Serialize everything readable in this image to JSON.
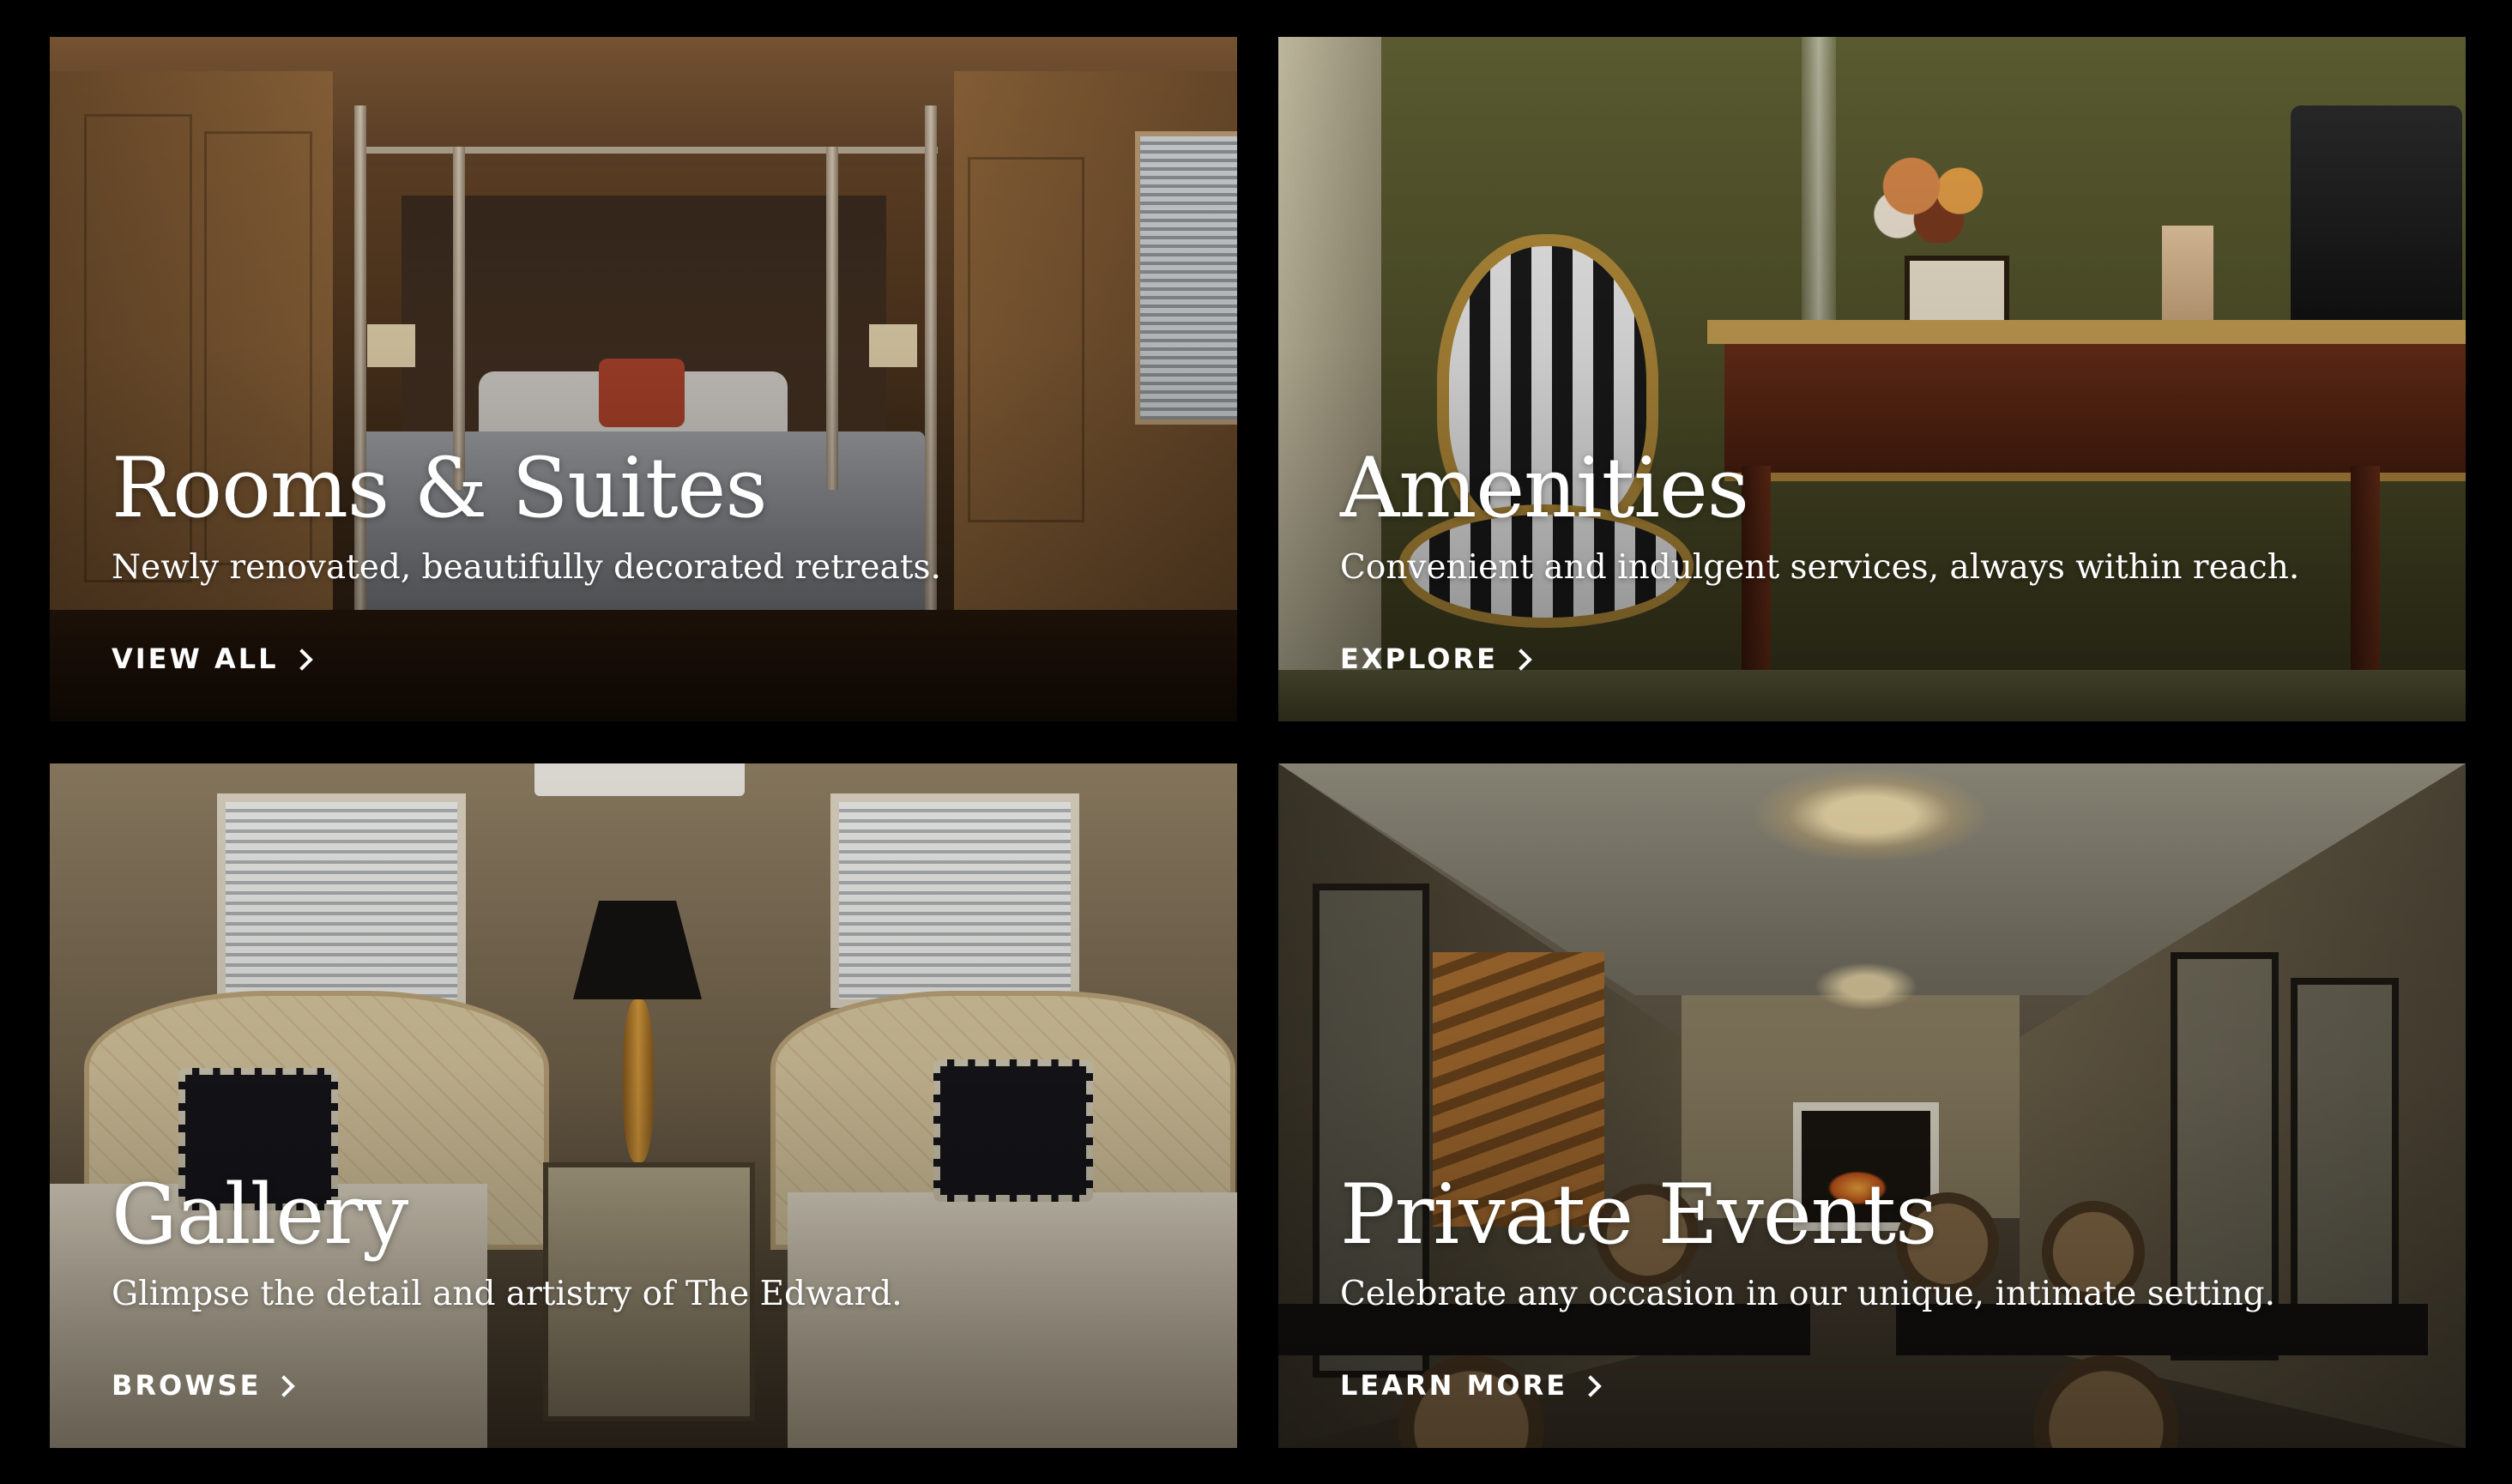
{
  "cards": [
    {
      "title": "Rooms & Suites",
      "subtitle": "Newly renovated, beautifully decorated retreats.",
      "cta": "VIEW ALL",
      "cta_icon": "chevron-right-icon"
    },
    {
      "title": "Amenities",
      "subtitle": "Convenient and indulgent services, always within reach.",
      "cta": "EXPLORE",
      "cta_icon": "chevron-right-icon"
    },
    {
      "title": "Gallery",
      "subtitle": "Glimpse the detail and artistry of The Edward.",
      "cta": "BROWSE",
      "cta_icon": "chevron-right-icon"
    },
    {
      "title": "Private Events",
      "subtitle": "Celebrate any occasion in our unique, intimate setting.",
      "cta": "LEARN MORE",
      "cta_icon": "chevron-right-icon"
    }
  ],
  "colors": {
    "background": "#000000",
    "text": "#ffffff"
  }
}
